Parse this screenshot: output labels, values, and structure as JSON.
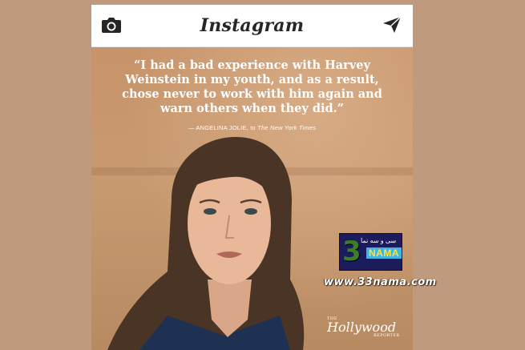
{
  "header": {
    "title": "Instagram",
    "camera_icon": "camera-icon",
    "direct_icon": "paper-plane-icon"
  },
  "post": {
    "quote": "“I had a bad experience with Harvey Weinstein in my youth, and as a result, chose never to work with him again and warn others when they did.”",
    "attribution_prefix": "— ANGELINA JOLIE, to",
    "attribution_publication": "The New York Times",
    "publisher_logo_the": "THE",
    "publisher_logo_name": "Hollywood",
    "publisher_logo_sub": "REPORTER"
  },
  "watermark": {
    "logo_number": "3",
    "logo_arabic": "سی و سه نما",
    "logo_text": "NAMA",
    "url": "www.33nama.com"
  },
  "colors": {
    "header_bg": "#ffffff",
    "page_bg": "#bf9a7e",
    "post_bg": "#c99a72",
    "text_dark": "#262626"
  }
}
